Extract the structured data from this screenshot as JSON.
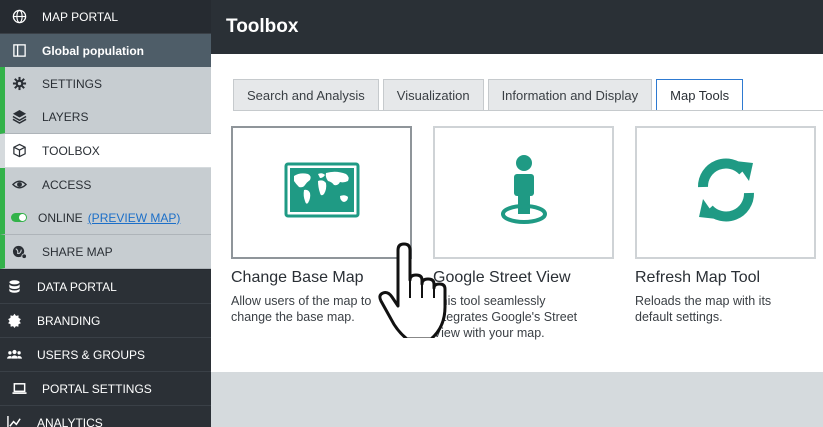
{
  "sidebar": {
    "items": [
      {
        "label": "MAP PORTAL",
        "icon": "globe-icon"
      },
      {
        "label": "Global population",
        "icon": "book-icon"
      },
      {
        "label": "SETTINGS",
        "icon": "gear-icon"
      },
      {
        "label": "LAYERS",
        "icon": "layers-icon"
      },
      {
        "label": "TOOLBOX",
        "icon": "box-icon"
      },
      {
        "label": "ACCESS",
        "icon": "eye-icon"
      },
      {
        "label": "ONLINE",
        "link": "(PREVIEW MAP)",
        "icon": "toggle-icon"
      },
      {
        "label": "SHARE MAP",
        "icon": "share-globe-icon"
      },
      {
        "label": "DATA PORTAL",
        "icon": "database-icon"
      },
      {
        "label": "BRANDING",
        "icon": "badge-icon"
      },
      {
        "label": "USERS & GROUPS",
        "icon": "users-icon"
      },
      {
        "label": "PORTAL SETTINGS",
        "icon": "laptop-icon"
      },
      {
        "label": "ANALYTICS",
        "icon": "chart-icon"
      }
    ],
    "accent": "#33b24a"
  },
  "header": {
    "title": "Toolbox"
  },
  "tabs": [
    {
      "label": "Search and Analysis"
    },
    {
      "label": "Visualization"
    },
    {
      "label": "Information and Display"
    },
    {
      "label": "Map Tools",
      "active": true
    }
  ],
  "tools": [
    {
      "title": "Change Base Map",
      "desc": "Allow users of the map to change the base map.",
      "icon": "world-map-icon"
    },
    {
      "title": "Google Street View",
      "desc": "This tool seamlessly integrates Google's Street View with your map.",
      "icon": "street-view-icon"
    },
    {
      "title": "Refresh Map Tool",
      "desc": "Reloads the map with its default settings.",
      "icon": "refresh-icon"
    }
  ],
  "colors": {
    "teal": "#1f9a84",
    "link": "#1c6fc8"
  }
}
